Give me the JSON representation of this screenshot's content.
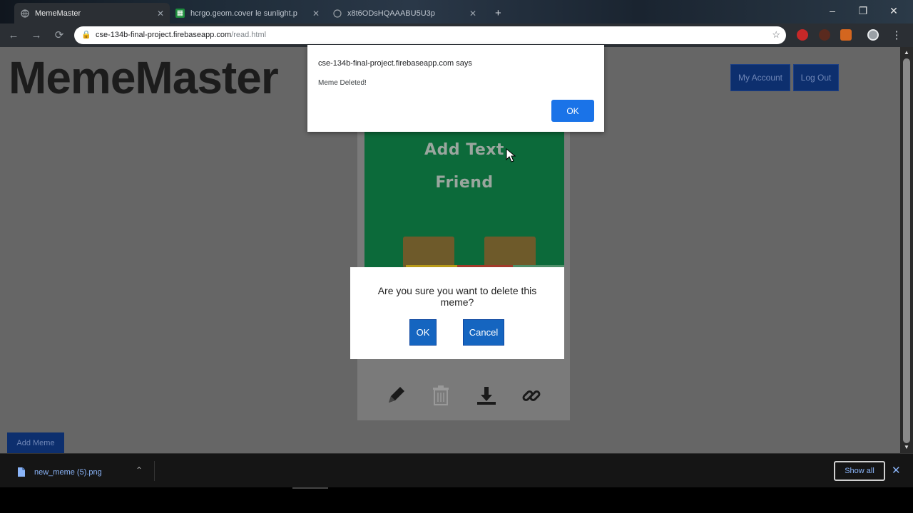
{
  "browser": {
    "tabs": [
      {
        "title": "MemeMaster",
        "active": true
      },
      {
        "title": "hcrgo.geom.cover le sunlight.p",
        "active": false
      },
      {
        "title": "x8t6ODsHQAAABU5U3p",
        "active": false
      }
    ],
    "new_tab_label": "+",
    "window_controls": {
      "minimize": "–",
      "restore": "❐",
      "close": "✕"
    },
    "url_host": "cse-134b-final-project.firebaseapp.com",
    "url_path": "/read.html"
  },
  "page": {
    "brand": "MemeMaster",
    "my_account_label": "My Account",
    "log_out_label": "Log Out",
    "add_meme_label": "Add Meme"
  },
  "meme": {
    "top_text": "Add Text",
    "bottom_text": "Friend",
    "background_color": "#0c6a3a",
    "actions": [
      "pencil-icon",
      "trash-icon",
      "download-icon",
      "link-icon"
    ]
  },
  "confirm_dialog": {
    "message": "Are you sure you want to delete this meme?",
    "ok_label": "OK",
    "cancel_label": "Cancel"
  },
  "alert_dialog": {
    "origin_text": "cse-134b-final-project.firebaseapp.com says",
    "message": "Meme Deleted!",
    "ok_label": "OK"
  },
  "download_bar": {
    "file_name": "new_meme (5).png",
    "show_all_label": "Show all"
  },
  "colors": {
    "page_overlay": "#666666",
    "primary_button": "#0d2f6e",
    "dialog_button": "#1565c0",
    "alert_button": "#1a73e8"
  }
}
